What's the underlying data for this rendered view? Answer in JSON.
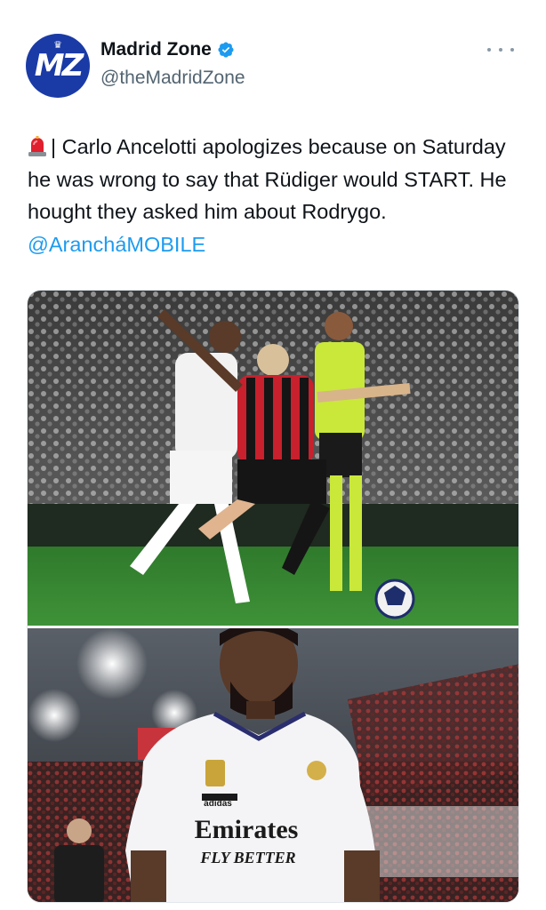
{
  "account": {
    "display_name": "Madrid Zone",
    "handle": "@theMadridZone",
    "avatar_text": "MZ"
  },
  "tweet": {
    "text": "| Carlo Ancelotti apologizes because on Saturday he was wrong to say that Rüdiger would START. He hought they asked him about Rodrygo. ",
    "mention": "@ArancháMOBILE"
  },
  "media": {
    "photo_top": {
      "subject": "football-match-action"
    },
    "photo_bottom": {
      "subject": "player-portrait",
      "shirt_sponsor_line1": "Emirates",
      "shirt_sponsor_line2": "FLY BETTER",
      "shirt_brand": "adidas"
    }
  },
  "colors": {
    "verified_badge": "#1d9bf0",
    "mention": "#1d9bf0",
    "avatar_bg": "#1a3aa6",
    "text": "#0f1419",
    "secondary_text": "#536471"
  },
  "icons": {
    "verified": "verified-badge-icon",
    "more": "more-options-icon",
    "siren": "siren-emoji-icon"
  }
}
